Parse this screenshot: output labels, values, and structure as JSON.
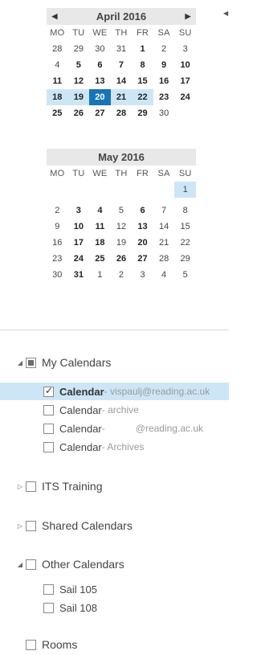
{
  "april": {
    "title": "April 2016",
    "dows": [
      "MO",
      "TU",
      "WE",
      "TH",
      "FR",
      "SA",
      "SU"
    ],
    "weeks": [
      [
        "28",
        "29",
        "30",
        "31",
        "1",
        "2",
        "3"
      ],
      [
        "4",
        "5",
        "6",
        "7",
        "8",
        "9",
        "10"
      ],
      [
        "11",
        "12",
        "13",
        "14",
        "15",
        "16",
        "17"
      ],
      [
        "18",
        "19",
        "20",
        "21",
        "22",
        "23",
        "24"
      ],
      [
        "25",
        "26",
        "27",
        "28",
        "29",
        "30",
        ""
      ]
    ]
  },
  "may": {
    "title": "May 2016",
    "dows": [
      "MO",
      "TU",
      "WE",
      "TH",
      "FR",
      "SA",
      "SU"
    ],
    "weeks": [
      [
        "",
        "",
        "",
        "",
        "",
        "",
        "1"
      ],
      [
        "2",
        "3",
        "4",
        "5",
        "6",
        "7",
        "8"
      ],
      [
        "9",
        "10",
        "11",
        "12",
        "13",
        "14",
        "15"
      ],
      [
        "16",
        "17",
        "18",
        "19",
        "20",
        "21",
        "22"
      ],
      [
        "23",
        "24",
        "25",
        "26",
        "27",
        "28",
        "29"
      ],
      [
        "30",
        "31",
        "1",
        "2",
        "3",
        "4",
        "5"
      ]
    ]
  },
  "folders": {
    "my_calendars": "My Calendars",
    "items": [
      {
        "label": "Calendar",
        "suffix": " - vispaulj@reading.ac.uk"
      },
      {
        "label": "Calendar",
        "suffix": " - archive"
      },
      {
        "label": "Calendar",
        "suffix_pre": " - ",
        "suffix_post": "@reading.ac.uk"
      },
      {
        "label": "Calendar",
        "suffix": " - Archives"
      }
    ],
    "its_training": "ITS Training",
    "shared_calendars": "Shared Calendars",
    "other_calendars": "Other Calendars",
    "other_items": [
      "Sail 105",
      "Sail 108"
    ],
    "rooms": "Rooms"
  },
  "icons": {
    "prev": "◀",
    "next": "▶",
    "expanded": "◢",
    "collapsed": "▷"
  }
}
